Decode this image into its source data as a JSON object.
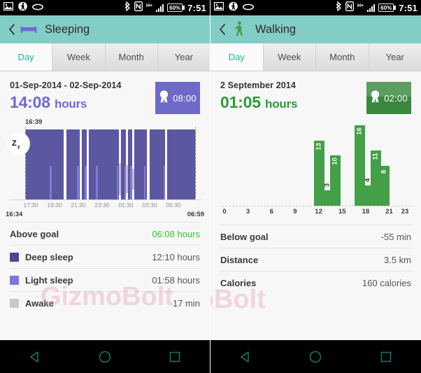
{
  "statusbar": {
    "time": "7:51",
    "battery_text": "60%",
    "network_text": "H+",
    "icons": [
      "image-icon",
      "walking-icon",
      "ring-icon",
      "bluetooth-icon",
      "nfc-icon",
      "signal-icon",
      "battery-icon"
    ]
  },
  "left": {
    "appbar": {
      "title": "Sleeping",
      "icon": "bed-icon",
      "back_icon": "back-chevron-icon"
    },
    "tabs": [
      {
        "label": "Day",
        "active": true
      },
      {
        "label": "Week",
        "active": false
      },
      {
        "label": "Month",
        "active": false
      },
      {
        "label": "Year",
        "active": false
      }
    ],
    "summary": {
      "date": "01-Sep-2014 - 02-Sep-2014",
      "value": "14:08",
      "unit": "hours",
      "badge_value": "08:00",
      "badge_icon": "medal-icon",
      "accent_color": "#6f69d4"
    },
    "chart": {
      "sleep_icon": "zzz-icon",
      "start_label": "16:39",
      "axis_start": "16:34",
      "axis_end": "06:59",
      "xticks": [
        "17:30",
        "19:30",
        "21:30",
        "23:30",
        "01:30",
        "03:30",
        "05:30"
      ],
      "deep_color": "#5b57a0",
      "light_color": "#7f7adc",
      "awake_color": "#ffffff"
    },
    "stats": [
      {
        "label": "Above goal",
        "value": "06:08 hours",
        "swatch": null,
        "value_color": "#31c531"
      },
      {
        "label": "Deep sleep",
        "value": "12:10 hours",
        "swatch": "#4b4792",
        "value_color": "#555555"
      },
      {
        "label": "Light sleep",
        "value": "01:58 hours",
        "swatch": "#7b76e0",
        "value_color": "#555555"
      },
      {
        "label": "Awake",
        "value": "17 min",
        "swatch": "#c9c9c9",
        "value_color": "#555555"
      }
    ]
  },
  "right": {
    "appbar": {
      "title": "Walking",
      "icon": "walking-person-icon",
      "back_icon": "back-chevron-icon"
    },
    "tabs": [
      {
        "label": "Day",
        "active": true
      },
      {
        "label": "Week",
        "active": false
      },
      {
        "label": "Month",
        "active": false
      },
      {
        "label": "Year",
        "active": false
      }
    ],
    "summary": {
      "date": "2 September 2014",
      "value": "01:05",
      "unit": "hours",
      "badge_value": "02:00",
      "badge_icon": "medal-icon",
      "accent_color": "#2e9b3b"
    },
    "stats": [
      {
        "label": "Below goal",
        "value": "-55 min",
        "swatch": null,
        "value_color": "#555555"
      },
      {
        "label": "Distance",
        "value": "3.5 km",
        "swatch": null,
        "value_color": "#555555"
      },
      {
        "label": "Calories",
        "value": "160 calories",
        "swatch": null,
        "value_color": "#555555"
      }
    ]
  },
  "navbar": {
    "buttons": [
      {
        "name": "back-button",
        "icon": "triangle-back-icon"
      },
      {
        "name": "home-button",
        "icon": "circle-home-icon"
      },
      {
        "name": "recents-button",
        "icon": "square-recents-icon"
      }
    ],
    "color": "#0f7a6e"
  },
  "watermark": {
    "text_left": "GizmoBolt",
    "text_right": "moBolt"
  },
  "chart_data": [
    {
      "type": "area",
      "title": "Sleeping",
      "xlabel": "",
      "ylabel": "",
      "axis_start": "16:34",
      "axis_end": "06:59",
      "tick_labels": [
        "17:30",
        "19:30",
        "21:30",
        "23:30",
        "01:30",
        "03:30",
        "05:30"
      ],
      "legend": [
        "Deep sleep",
        "Light sleep",
        "Awake"
      ],
      "segments": [
        {
          "start_pct": 0.0,
          "end_pct": 22.5,
          "type": "deep"
        },
        {
          "start_pct": 22.5,
          "end_pct": 24.0,
          "type": "awake"
        },
        {
          "start_pct": 24.0,
          "end_pct": 32.0,
          "type": "deep"
        },
        {
          "start_pct": 32.0,
          "end_pct": 33.3,
          "type": "awake"
        },
        {
          "start_pct": 33.3,
          "end_pct": 36.0,
          "type": "deep"
        },
        {
          "start_pct": 36.0,
          "end_pct": 37.4,
          "type": "awake"
        },
        {
          "start_pct": 37.4,
          "end_pct": 54.8,
          "type": "deep"
        },
        {
          "start_pct": 54.8,
          "end_pct": 56.1,
          "type": "awake"
        },
        {
          "start_pct": 56.1,
          "end_pct": 59.0,
          "type": "deep"
        },
        {
          "start_pct": 59.0,
          "end_pct": 60.2,
          "type": "awake"
        },
        {
          "start_pct": 60.2,
          "end_pct": 62.6,
          "type": "deep"
        },
        {
          "start_pct": 62.6,
          "end_pct": 63.8,
          "type": "awake"
        },
        {
          "start_pct": 63.8,
          "end_pct": 71.5,
          "type": "deep"
        },
        {
          "start_pct": 71.5,
          "end_pct": 73.0,
          "type": "awake"
        },
        {
          "start_pct": 73.0,
          "end_pct": 82.0,
          "type": "deep"
        },
        {
          "start_pct": 82.0,
          "end_pct": 83.3,
          "type": "awake"
        },
        {
          "start_pct": 83.3,
          "end_pct": 100.0,
          "type": "deep"
        }
      ],
      "light_markers": [
        14.5,
        30.5,
        35.0,
        41.5,
        53.5,
        58.0,
        61.5,
        69.5,
        81.0
      ],
      "totals": {
        "deep_sleep": "12:10 hours",
        "light_sleep": "01:58 hours",
        "awake": "17 min",
        "above_goal": "06:08 hours",
        "total": "14:08 hours"
      }
    },
    {
      "type": "bar",
      "title": "Walking",
      "xlabel": "",
      "ylabel": "",
      "x": [
        11,
        12,
        13,
        16,
        17,
        18,
        19
      ],
      "values": [
        13,
        3,
        10,
        16,
        4,
        11,
        8
      ],
      "xlim": [
        0,
        23
      ],
      "ylim": [
        0,
        16
      ],
      "tick_labels": [
        "0",
        "3",
        "6",
        "9",
        "12",
        "15",
        "18",
        "21",
        "23"
      ],
      "bar_color": "#43a047",
      "totals": {
        "duration": "01:05 hours",
        "below_goal": "-55 min",
        "distance": "3.5 km",
        "calories": "160 calories"
      }
    }
  ]
}
